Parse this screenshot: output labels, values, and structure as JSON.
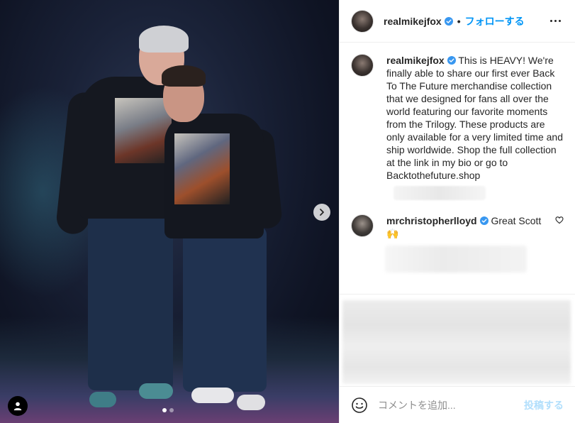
{
  "header": {
    "username": "realmikejfox",
    "separator": "•",
    "follow_label": "フォローする"
  },
  "caption": {
    "username": "realmikejfox",
    "text": "This is HEAVY! We're finally able to share our first ever Back To The Future merchandise collection that we designed for fans all over the world featuring our favorite moments from the Trilogy. These products are only available for a very limited time and ship worldwide. Shop the full collection at the link in my bio or go to Backtothefuture.shop"
  },
  "comments": [
    {
      "username": "mrchristopherlloyd",
      "text": "Great Scott 🙌"
    }
  ],
  "add_comment": {
    "placeholder": "コメントを追加...",
    "post_label": "投稿する"
  },
  "carousel": {
    "current": 1,
    "total": 2
  },
  "colors": {
    "accent": "#0095f6",
    "verified": "#3897f0",
    "post_disabled": "#b2dffc"
  }
}
